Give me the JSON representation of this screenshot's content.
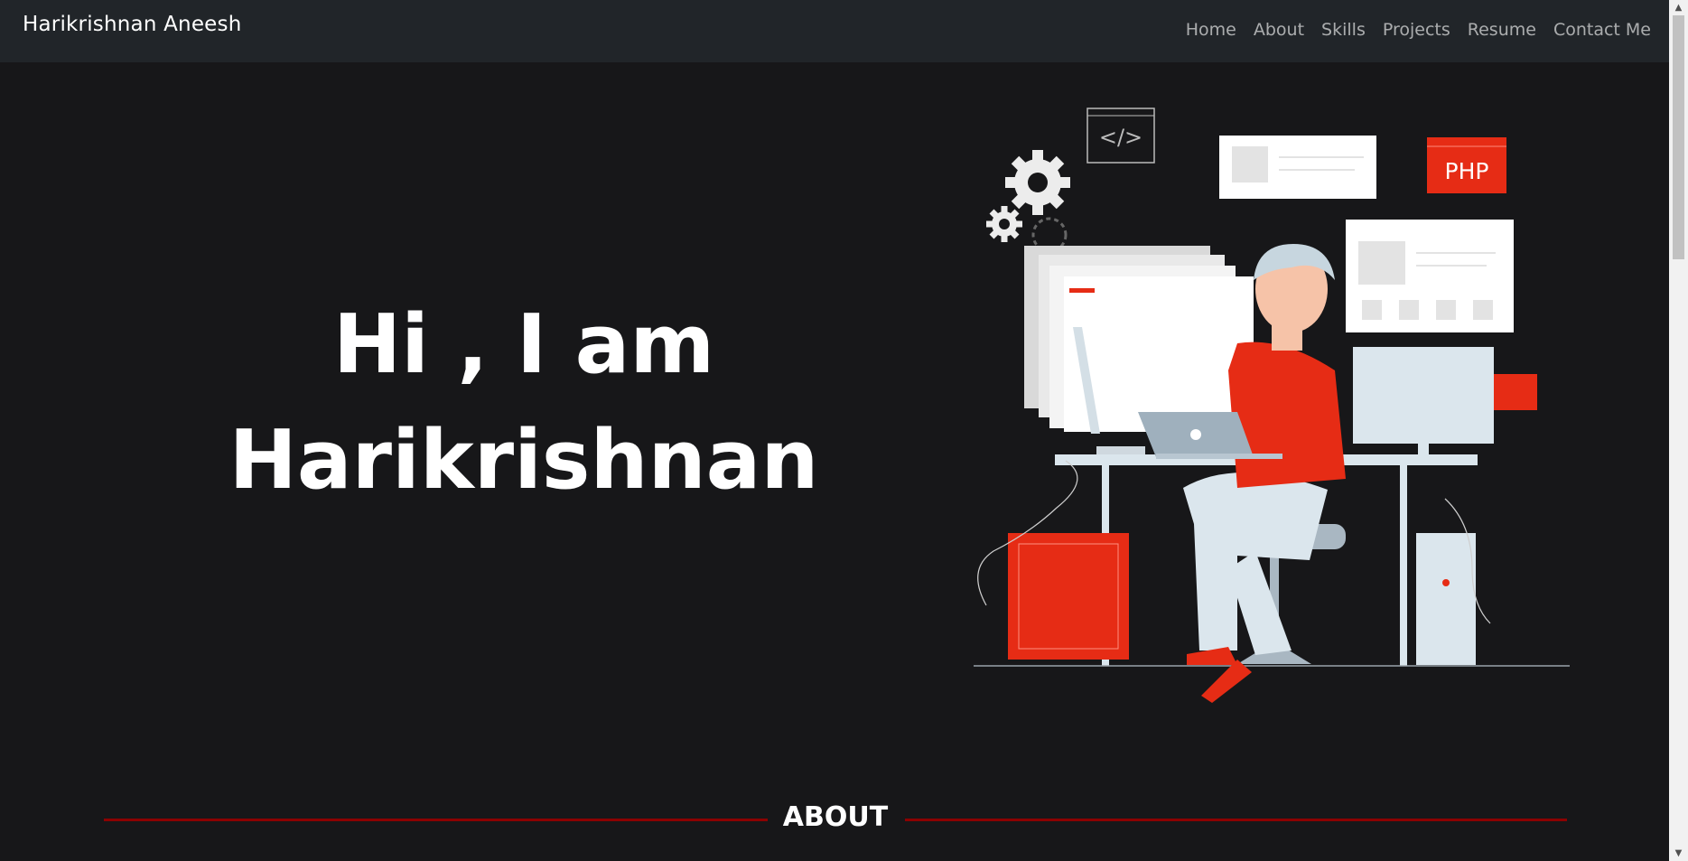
{
  "navbar": {
    "brand": "Harikrishnan Aneesh",
    "links": [
      "Home",
      "About",
      "Skills",
      "Projects",
      "Resume",
      "Contact Me"
    ]
  },
  "hero": {
    "line1": "Hi , I am",
    "line2": "Harikrishnan",
    "illustration": {
      "badge_text": "PHP",
      "code_icon_text": "</>"
    }
  },
  "about": {
    "title": "ABOUT"
  },
  "colors": {
    "background": "#171719",
    "navbar": "#212529",
    "accent_red": "#e62c15",
    "divider_red": "#8c0000"
  }
}
